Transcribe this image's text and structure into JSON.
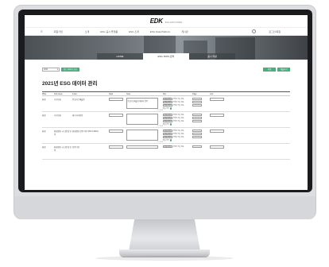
{
  "header": {
    "logo": "EDK",
    "logo_sub": "ESG DATA KOREA"
  },
  "nav": {
    "items": [
      "회원가입",
      "소개",
      "ESG 공시 플랫폼",
      "ESG 소개",
      "ESG Data Platform",
      "게시판"
    ],
    "login": "로그인/회원"
  },
  "tabs": [
    "HOME",
    "ESG DATA 관리",
    "공시 작성"
  ],
  "filter": {
    "year": "2021",
    "year_button": "연도 데이터 조회",
    "save": "저장",
    "submit": "제출하기"
  },
  "page_title": "2021년 ESG 데이터 관리",
  "table": {
    "columns": [
      "Pillar",
      "Sub-Issue",
      "Index",
      "Data",
      "Note",
      "File",
      "Page",
      "Link"
    ],
    "rows": [
      {
        "pillar": "환경",
        "sub": "기후변화",
        "index": "온실가스배출량",
        "note": "온실가스배출량 데이터 입력",
        "count": "0 / 2000",
        "files": [
          "파일 선택",
          "파일 선택",
          "파일 선택"
        ],
        "file_text": "선택된 파일 없음",
        "add": "파일 추가"
      },
      {
        "pillar": "환경",
        "sub": "기후변화",
        "index": "에너지사용량",
        "note": "",
        "count": "0 / 2000",
        "files": [
          "파일 선택",
          "파일 선택",
          "파일 선택"
        ],
        "file_text": "선택된 파일 없음",
        "add": "파일 추가"
      },
      {
        "pillar": "환경",
        "sub": "환경경영 시스템 및 인증",
        "index": "환경경영 인증 여부 (ISO 14001)",
        "note": "",
        "count": "0 / 2000",
        "files": [
          "파일 선택",
          "파일 선택",
          "파일 선택"
        ],
        "file_text": "선택된 파일 없음",
        "add": "파일 추가"
      },
      {
        "pillar": "환경",
        "sub": "환경경영 시스템 및 인증",
        "index": "인증기관",
        "note": "",
        "count": "",
        "files": [
          "파일 선택"
        ],
        "file_text": "선택된 파일 없음",
        "add": ""
      }
    ]
  }
}
